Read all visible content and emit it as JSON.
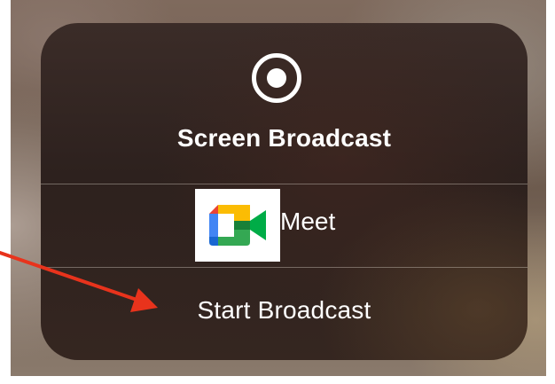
{
  "panel": {
    "icon": "record-icon",
    "title": "Screen Broadcast"
  },
  "options": [
    {
      "label": "Meet",
      "icon": "google-meet-logo"
    }
  ],
  "start_label": "Start Broadcast",
  "colors": {
    "arrow": "#e8331c",
    "panel_text": "#ffffff"
  }
}
